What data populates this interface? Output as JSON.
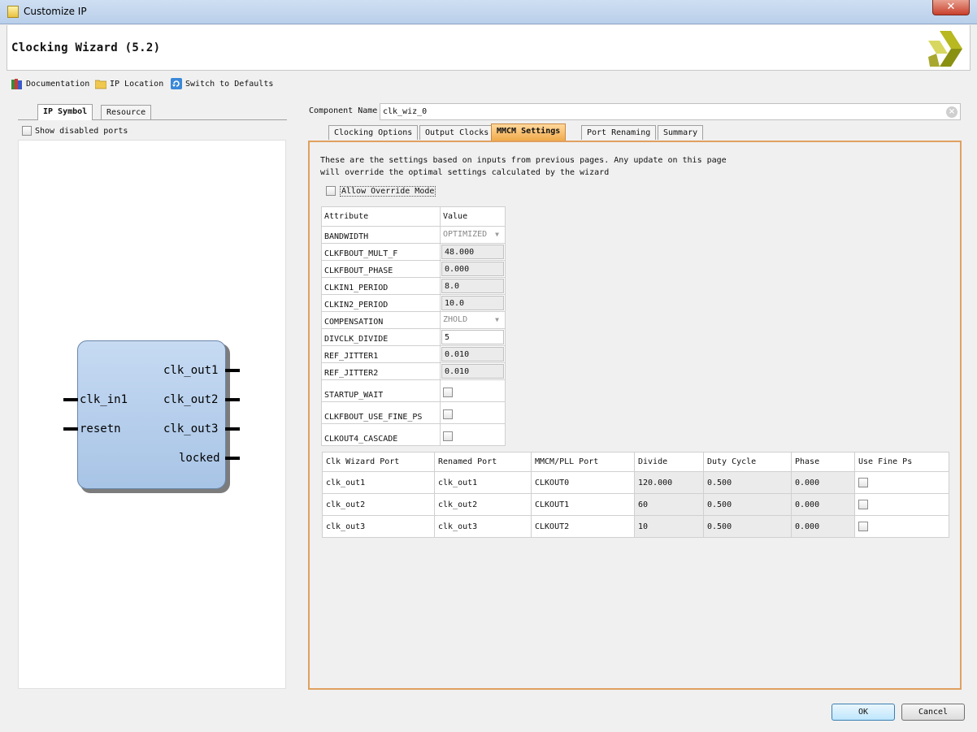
{
  "window": {
    "title": "Customize IP",
    "close_label": "✕"
  },
  "header": {
    "title": "Clocking Wizard (5.2)"
  },
  "toolbar": {
    "documentation": "Documentation",
    "ip_location": "IP Location",
    "switch_defaults": "Switch to Defaults"
  },
  "left_panel": {
    "tabs": [
      "IP Symbol",
      "Resource"
    ],
    "show_disabled_ports": "Show disabled ports",
    "symbol": {
      "inputs": [
        "clk_in1",
        "resetn"
      ],
      "outputs": [
        "clk_out1",
        "clk_out2",
        "clk_out3",
        "locked"
      ]
    }
  },
  "component": {
    "label": "Component Name",
    "value": "clk_wiz_0"
  },
  "tabs": [
    "Clocking Options",
    "Output Clocks",
    "MMCM Settings",
    "Port Renaming",
    "Summary"
  ],
  "mmcm": {
    "description_line1": "These are the settings based on inputs from previous pages. Any update on this page",
    "description_line2": "will override the optimal settings calculated by the wizard",
    "allow_override": "Allow Override Mode",
    "attr_headers": [
      "Attribute",
      "Value"
    ],
    "attributes": [
      {
        "name": "BANDWIDTH",
        "value": "OPTIMIZED"
      },
      {
        "name": "CLKFBOUT_MULT_F",
        "value": "48.000"
      },
      {
        "name": "CLKFBOUT_PHASE",
        "value": "0.000"
      },
      {
        "name": "CLKIN1_PERIOD",
        "value": "8.0"
      },
      {
        "name": "CLKIN2_PERIOD",
        "value": "10.0"
      },
      {
        "name": "COMPENSATION",
        "value": "ZHOLD"
      },
      {
        "name": "DIVCLK_DIVIDE",
        "value": "5"
      },
      {
        "name": "REF_JITTER1",
        "value": "0.010"
      },
      {
        "name": "REF_JITTER2",
        "value": "0.010"
      },
      {
        "name": "STARTUP_WAIT"
      },
      {
        "name": "CLKFBOUT_USE_FINE_PS"
      },
      {
        "name": "CLKOUT4_CASCADE"
      }
    ],
    "port_headers": [
      "Clk Wizard Port",
      "Renamed Port",
      "MMCM/PLL Port",
      "Divide",
      "Duty Cycle",
      "Phase",
      "Use Fine Ps"
    ],
    "ports": [
      {
        "port": "clk_out1",
        "renamed": "clk_out1",
        "mmcm": "CLKOUT0",
        "divide": "120.000",
        "duty": "0.500",
        "phase": "0.000"
      },
      {
        "port": "clk_out2",
        "renamed": "clk_out2",
        "mmcm": "CLKOUT1",
        "divide": "60",
        "duty": "0.500",
        "phase": "0.000"
      },
      {
        "port": "clk_out3",
        "renamed": "clk_out3",
        "mmcm": "CLKOUT2",
        "divide": "10",
        "duty": "0.500",
        "phase": "0.000"
      }
    ]
  },
  "buttons": {
    "ok": "OK",
    "cancel": "Cancel"
  },
  "colors": {
    "active_tab": "#f0a848",
    "frame": "#e0a060",
    "ip_block": "#b8d0ee"
  }
}
